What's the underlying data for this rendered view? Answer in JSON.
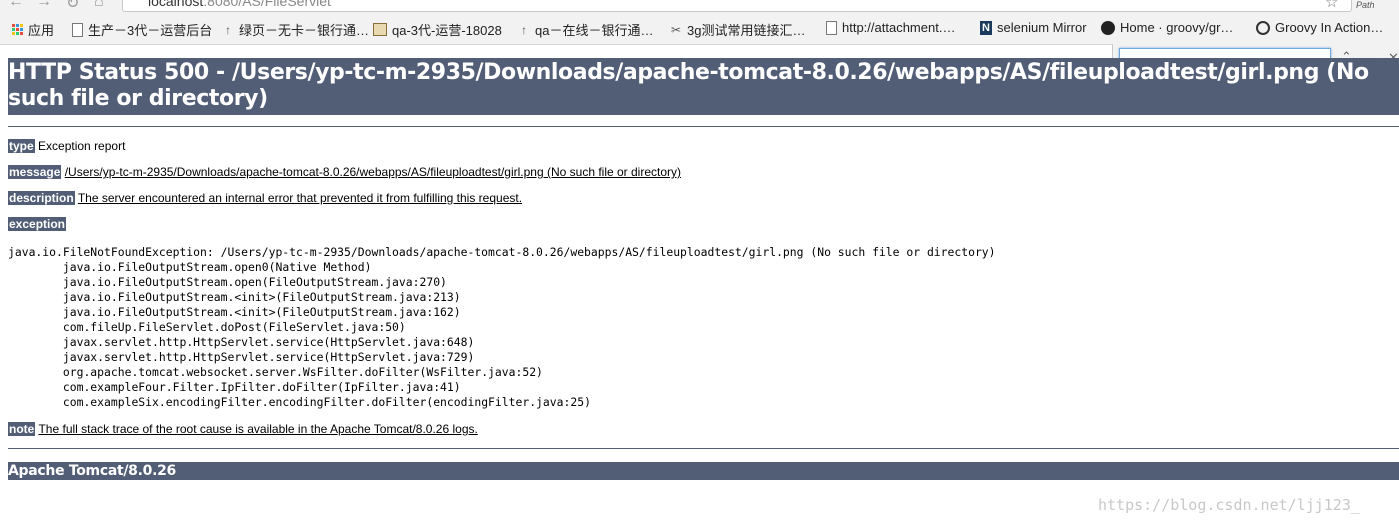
{
  "browser": {
    "url_host": "localhost",
    "url_path": ":8080/AS/FileServlet",
    "extension_label": "Path",
    "bookmarks": [
      {
        "label": "应用",
        "icon": "apps-grid-icon"
      },
      {
        "label": "生产－3代－运营后台",
        "icon": "page-icon"
      },
      {
        "label": "绿页－无卡－银行通…",
        "icon": "arrow-up-icon"
      },
      {
        "label": "qa-3代-运营-18028",
        "icon": "image-icon"
      },
      {
        "label": "qa－在线－银行通…",
        "icon": "arrow-up-icon"
      },
      {
        "label": "3g测试常用链接汇…",
        "icon": "scissors-icon"
      },
      {
        "label": "http://attachment.…",
        "icon": "page-icon"
      },
      {
        "label": "selenium Mirror",
        "icon": "n-logo-icon"
      },
      {
        "label": "Home · groovy/gr…",
        "icon": "github-icon"
      },
      {
        "label": "Groovy In Action…",
        "icon": "groovy-icon"
      }
    ],
    "find_value": ""
  },
  "error_page": {
    "title": "HTTP Status 500 - /Users/yp-tc-m-2935/Downloads/apache-tomcat-8.0.26/webapps/AS/fileuploadtest/girl.png (No such file or directory)",
    "type_label": "type",
    "type_value": "Exception report",
    "message_label": "message",
    "message_value": "/Users/yp-tc-m-2935/Downloads/apache-tomcat-8.0.26/webapps/AS/fileuploadtest/girl.png (No such file or directory)",
    "description_label": "description",
    "description_value": "The server encountered an internal error that prevented it from fulfilling this request.",
    "exception_label": "exception",
    "stack_trace": [
      "java.io.FileNotFoundException: /Users/yp-tc-m-2935/Downloads/apache-tomcat-8.0.26/webapps/AS/fileuploadtest/girl.png (No such file or directory)",
      "\tjava.io.FileOutputStream.open0(Native Method)",
      "\tjava.io.FileOutputStream.open(FileOutputStream.java:270)",
      "\tjava.io.FileOutputStream.<init>(FileOutputStream.java:213)",
      "\tjava.io.FileOutputStream.<init>(FileOutputStream.java:162)",
      "\tcom.fileUp.FileServlet.doPost(FileServlet.java:50)",
      "\tjavax.servlet.http.HttpServlet.service(HttpServlet.java:648)",
      "\tjavax.servlet.http.HttpServlet.service(HttpServlet.java:729)",
      "\torg.apache.tomcat.websocket.server.WsFilter.doFilter(WsFilter.java:52)",
      "\tcom.exampleFour.Filter.IpFilter.doFilter(IpFilter.java:41)",
      "\tcom.exampleSix.encodingFilter.encodingFilter.doFilter(encodingFilter.java:25)"
    ],
    "note_label": "note",
    "note_value": "The full stack trace of the root cause is available in the Apache Tomcat/8.0.26 logs.",
    "footer": "Apache Tomcat/8.0.26"
  },
  "watermark": "https://blog.csdn.net/ljj123_",
  "colors": {
    "header_bg": "#525D76",
    "header_text": "#FFFFFF"
  }
}
